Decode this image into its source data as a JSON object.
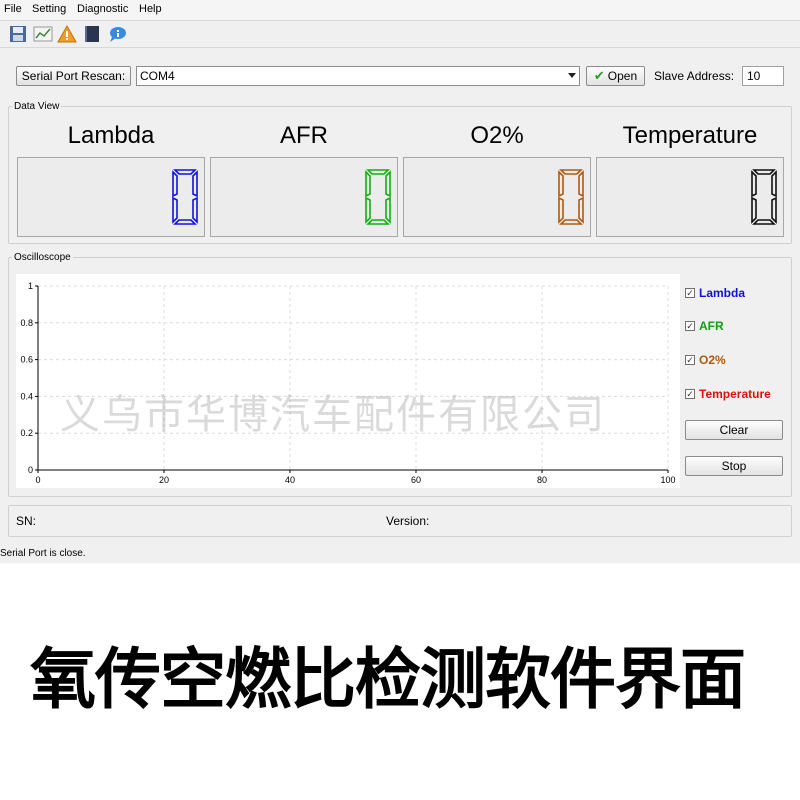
{
  "menu": {
    "items": [
      "File",
      "Setting",
      "Diagnostic",
      "Help"
    ]
  },
  "toolbar": {
    "icons": [
      "save-icon",
      "chart-icon",
      "warning-icon",
      "book-icon",
      "info-icon"
    ]
  },
  "connection": {
    "rescan_label": "Serial Port Rescan:",
    "port_value": "COM4",
    "open_label": "Open",
    "slave_label": "Slave Address:",
    "slave_value": "10"
  },
  "data_view": {
    "group_title": "Data View",
    "panels": [
      {
        "title": "Lambda",
        "value": "0",
        "color": "#1010e0"
      },
      {
        "title": "AFR",
        "value": "0",
        "color": "#10b010"
      },
      {
        "title": "O2%",
        "value": "0",
        "color": "#b05a10"
      },
      {
        "title": "Temperature",
        "value": "0",
        "color": "#101010"
      }
    ]
  },
  "oscilloscope": {
    "group_title": "Oscilloscope",
    "channels": [
      {
        "label": "Lambda",
        "checked": true,
        "color": "#1010e0"
      },
      {
        "label": "AFR",
        "checked": true,
        "color": "#10a010"
      },
      {
        "label": "O2%",
        "checked": true,
        "color": "#b05a10"
      },
      {
        "label": "Temperature",
        "checked": true,
        "color": "#e01010"
      }
    ],
    "clear_label": "Clear",
    "stop_label": "Stop"
  },
  "chart_data": {
    "type": "line",
    "title": "",
    "xlabel": "",
    "ylabel": "",
    "xlim": [
      0,
      100
    ],
    "ylim": [
      0,
      1
    ],
    "x_ticks": [
      "0",
      "20",
      "40",
      "60",
      "80",
      "100"
    ],
    "y_ticks": [
      "0",
      "0.2",
      "0.4",
      "0.6",
      "0.8",
      "1"
    ],
    "grid": true,
    "series": []
  },
  "info": {
    "sn_label": "SN:",
    "version_label": "Version:"
  },
  "status": "Serial Port is close.",
  "watermark": "义乌市华博汽车配件有限公司",
  "caption": "氧传空燃比检测软件界面"
}
